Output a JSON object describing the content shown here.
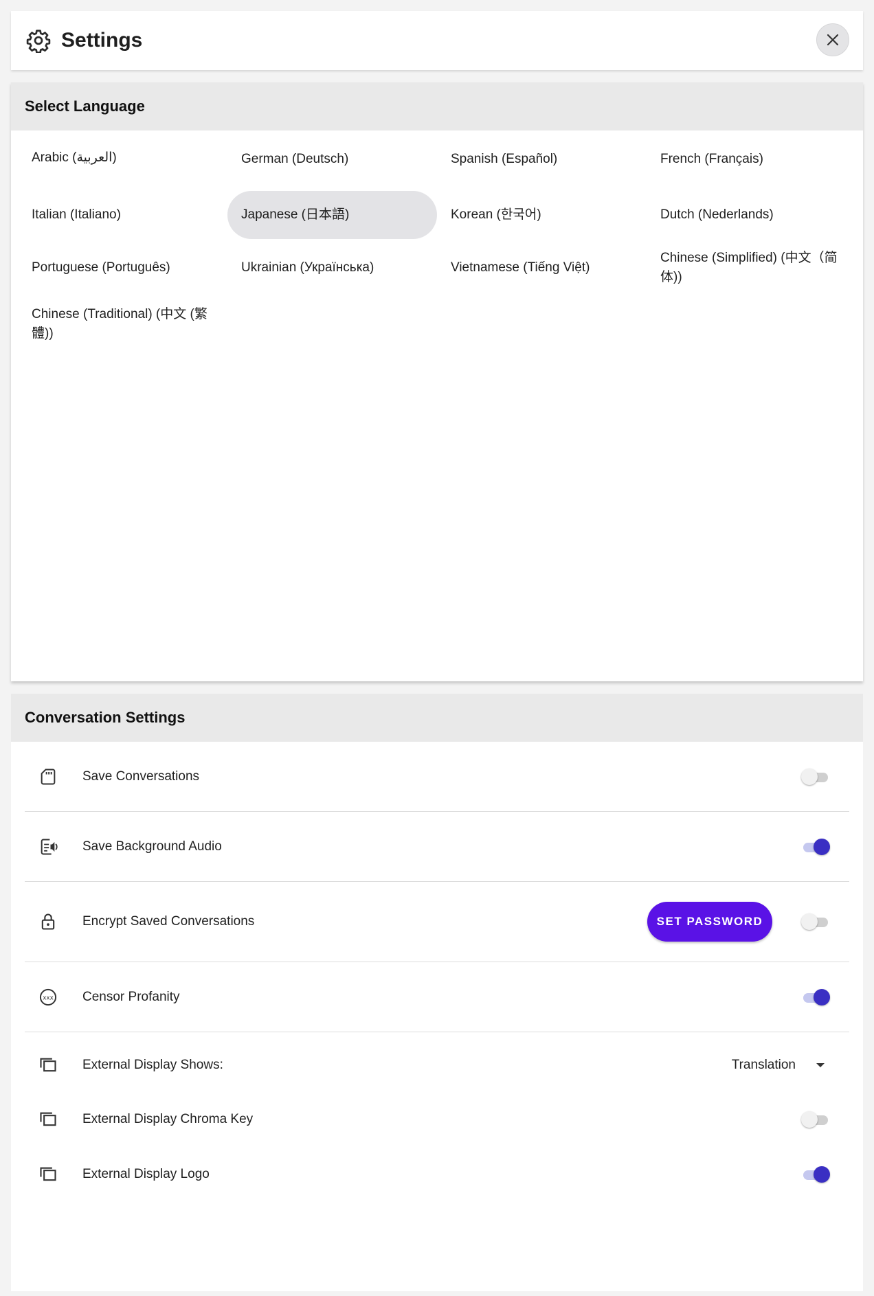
{
  "header": {
    "title": "Settings",
    "icon": "gear-icon",
    "close_icon": "close-icon"
  },
  "language": {
    "heading": "Select Language",
    "selected": "Japanese (日本語)",
    "items": [
      "Arabic (العربية)",
      "German (Deutsch)",
      "Spanish (Español)",
      "French (Français)",
      "Italian (Italiano)",
      "Japanese (日本語)",
      "Korean (한국어)",
      "Dutch (Nederlands)",
      "Portuguese (Português)",
      "Ukrainian (Українська)",
      "Vietnamese (Tiếng Việt)",
      "Chinese (Simplified) (中文（简体))",
      "Chinese (Traditional) (中文 (繁體))"
    ]
  },
  "conversation": {
    "heading": "Conversation Settings",
    "save_conversations": {
      "label": "Save Conversations",
      "enabled": false
    },
    "save_background_audio": {
      "label": "Save Background Audio",
      "enabled": true
    },
    "encrypt": {
      "label": "Encrypt Saved Conversations",
      "button": "SET PASSWORD",
      "enabled": false
    },
    "censor": {
      "label": "Censor Profanity",
      "enabled": true
    },
    "external_display_shows": {
      "label": "External Display Shows:",
      "value": "Translation"
    },
    "chroma_key": {
      "label": "External Display Chroma Key",
      "enabled": false
    },
    "logo": {
      "label": "External Display Logo",
      "enabled": true
    }
  },
  "colors": {
    "accent": "#3a2fc3",
    "button": "#5a12e6",
    "section_header_bg": "#e9e9e9",
    "selected_bg": "#e3e3e6"
  }
}
